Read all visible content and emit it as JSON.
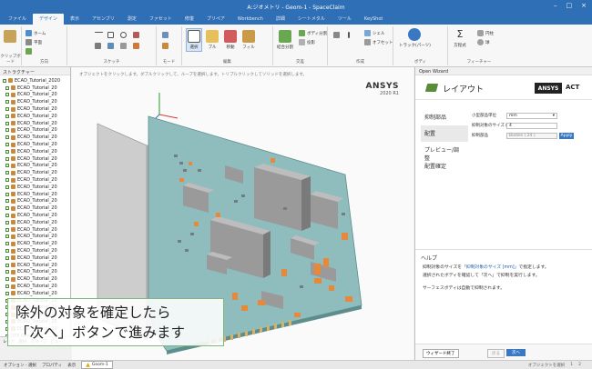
{
  "window": {
    "title": "A:ジオメトリ - Geom-1 - SpaceClaim"
  },
  "ribbon": {
    "tabs": [
      "ファイル",
      "デザイン",
      "表示",
      "アセンブリ",
      "測定",
      "ファセット",
      "修復",
      "プリペア",
      "Workbench",
      "詳細",
      "シートメタル",
      "ツール",
      "KeyShot"
    ],
    "active_tab": "デザイン",
    "groups": {
      "clipboard": "クリップボード",
      "orient": "方向",
      "sketch": "スケッチ",
      "mode": "モード",
      "edit": "編集",
      "intersect": "交差",
      "create": "作成",
      "body": "ボディ",
      "feature": "フィーチャー"
    },
    "buttons": {
      "home": "ホーム",
      "plane": "平面",
      "select": "選択",
      "pull": "プル",
      "move": "移動",
      "fill": "フィル",
      "combine": "結合分割",
      "body_split": "ボディ分割",
      "project": "投影",
      "shell": "シェル",
      "offset": "オフセット",
      "track": "トラック(パーツ)",
      "equation": "方程式",
      "cylinder": "円柱",
      "sphere": "球"
    }
  },
  "structure_panel": {
    "header": "ストラクチャー",
    "root": "ECAD_Tutorial_2020",
    "items": [
      "ECAD_Tutorial_20",
      "ECAD_Tutorial_20",
      "ECAD_Tutorial_20",
      "ECAD_Tutorial_20",
      "ECAD_Tutorial_20",
      "ECAD_Tutorial_20",
      "ECAD_Tutorial_20",
      "ECAD_Tutorial_20",
      "ECAD_Tutorial_20",
      "ECAD_Tutorial_20",
      "ECAD_Tutorial_20",
      "ECAD_Tutorial_20",
      "ECAD_Tutorial_20",
      "ECAD_Tutorial_20",
      "ECAD_Tutorial_20",
      "ECAD_Tutorial_20",
      "ECAD_Tutorial_20",
      "ECAD_Tutorial_20",
      "ECAD_Tutorial_20",
      "ECAD_Tutorial_20",
      "ECAD_Tutorial_20",
      "ECAD_Tutorial_20",
      "ECAD_Tutorial_20",
      "ECAD_Tutorial_20",
      "ECAD_Tutorial_20",
      "ECAD_Tutorial_20",
      "ECAD_Tutorial_20",
      "ECAD_Tutorial_20",
      "ECAD_Tutorial_20",
      "ECAD_Tutorial_20",
      "ECAD_Tutorial_20",
      "ECAD_Tutorial_20",
      "ECAD_Tutorial_20",
      "ECAD_Tutorial_20",
      "ECAD_Tutorial_20"
    ],
    "last_item": "STP Geometry",
    "bottom_tabs": [
      "レイヤ",
      "選択",
      "グループ",
      "ビュー"
    ],
    "bottom_tabs2": [
      "オプション - 選択",
      "プロパティ",
      "表示"
    ]
  },
  "viewport": {
    "hint": "オブジェクトをクリックします。ダブルクリックして、ループを選択します。トリプルクリックしてソリッドを選択します。",
    "logo_text": "ANSYS",
    "logo_version": "2020 R1"
  },
  "wizard": {
    "header": "Open Wizard",
    "title": "レイアウト",
    "logo": "ANSYS",
    "logo_suffix": "ACT",
    "steps": [
      "抑制部品",
      "配置",
      "プレビュー/調整",
      "配置確定"
    ],
    "active_step": "抑制部品",
    "fields": {
      "unit_label": "小型部品単位",
      "unit_value": "mm",
      "size_label": "抑制対象のサイズ [mm]",
      "size_value": "4",
      "parts_label": "抑制部品",
      "parts_value": "Bodies ( 24 )",
      "apply": "Apply"
    },
    "help": {
      "title": "ヘルプ",
      "line1_pre": "抑制対象のサイズを",
      "line1_hl": "「抑制対象のサイズ [mm]」",
      "line1_post": "で指定します。",
      "line2": "選択されたボディを確認して「次へ」で抑制を実行します。",
      "line3": "サーフェスボディは自動で抑制されます。"
    },
    "footer": {
      "finish": "ウィザード終了",
      "back": "戻る",
      "next": "次へ"
    }
  },
  "statusbar": {
    "doc_tab": "Geom-1",
    "right_items": [
      "オブジェクトを選択",
      "1",
      "2"
    ]
  },
  "subtitle": {
    "line1": "除外の対象を確定したら",
    "line2": "「次へ」ボタンで進みます"
  },
  "colors": {
    "brand_blue": "#2f6fb5",
    "board_green": "#8fbcbc",
    "component_orange": "#e8883a",
    "component_gray": "#9a9a9a"
  }
}
